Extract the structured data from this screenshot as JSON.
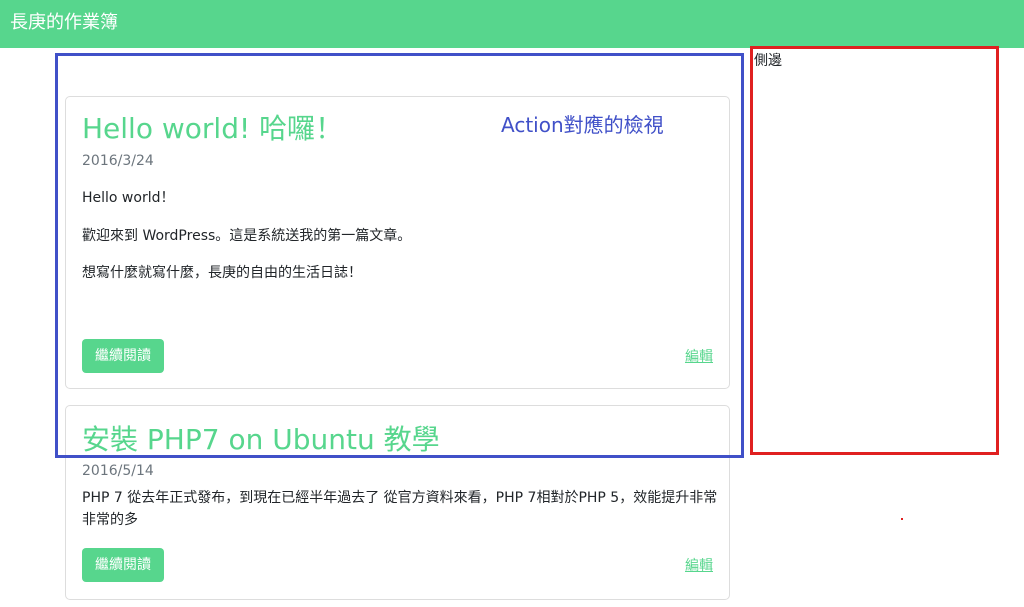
{
  "navbar": {
    "brand": "長庚的作業簿"
  },
  "posts": [
    {
      "title": "Hello world! 哈囉！",
      "date": "2016/3/24",
      "body": [
        "Hello world！",
        "歡迎來到 WordPress。這是系統送我的第一篇文章。",
        "想寫什麼就寫什麼，長庚的自由的生活日誌！"
      ],
      "read_more": "繼續閱讀",
      "edit": "編輯"
    },
    {
      "title": "安裝 PHP7 on Ubuntu 教學",
      "date": "2016/5/14",
      "excerpt": "PHP 7 從去年正式發布，到現在已經半年過去了 從官方資料來看，PHP 7相對於PHP 5，效能提升非常非常的多",
      "read_more": "繼續閱讀",
      "edit": "編輯"
    }
  ],
  "annotations": {
    "action_view_label": "Action對應的檢視",
    "sidebar_label": "側邊",
    "blue": "#4050c8",
    "red": "#e02020"
  },
  "colors": {
    "accent": "#57d68d"
  }
}
